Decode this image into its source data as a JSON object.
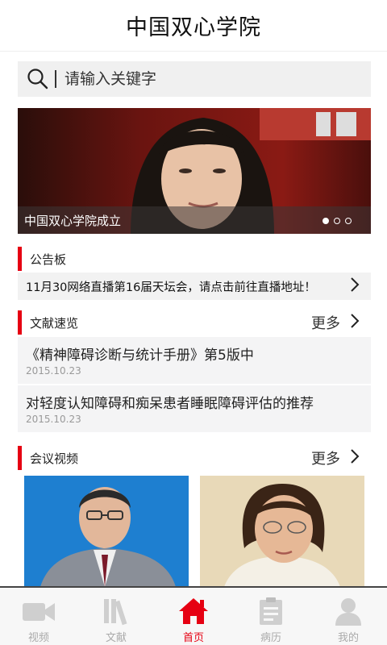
{
  "header": {
    "title": "中国双心学院"
  },
  "search": {
    "placeholder": "请输入关键字"
  },
  "banner": {
    "caption": "中国双心学院成立",
    "slide_count": 3,
    "active_slide": 1
  },
  "notice": {
    "section_title": "公告板",
    "text": "11月30网络直播第16届天坛会，请点击前往直播地址！"
  },
  "literature": {
    "section_title": "文献速览",
    "more_label": "更多",
    "items": [
      {
        "title": "《精神障碍诊断与统计手册》第5版中",
        "date": "2015.10.23"
      },
      {
        "title": "对轻度认知障碍和痴呆患者睡眠障碍评估的推荐",
        "date": "2015.10.23"
      }
    ]
  },
  "videos": {
    "section_title": "会议视频",
    "more_label": "更多"
  },
  "tabbar": {
    "items": [
      {
        "label": "视频",
        "icon": "video-camera-icon",
        "active": false
      },
      {
        "label": "文献",
        "icon": "books-icon",
        "active": false
      },
      {
        "label": "首页",
        "icon": "home-icon",
        "active": true
      },
      {
        "label": "病历",
        "icon": "clipboard-icon",
        "active": false
      },
      {
        "label": "我的",
        "icon": "person-icon",
        "active": false
      }
    ]
  },
  "colors": {
    "accent": "#e60012",
    "inactive": "#aaaaaa"
  }
}
